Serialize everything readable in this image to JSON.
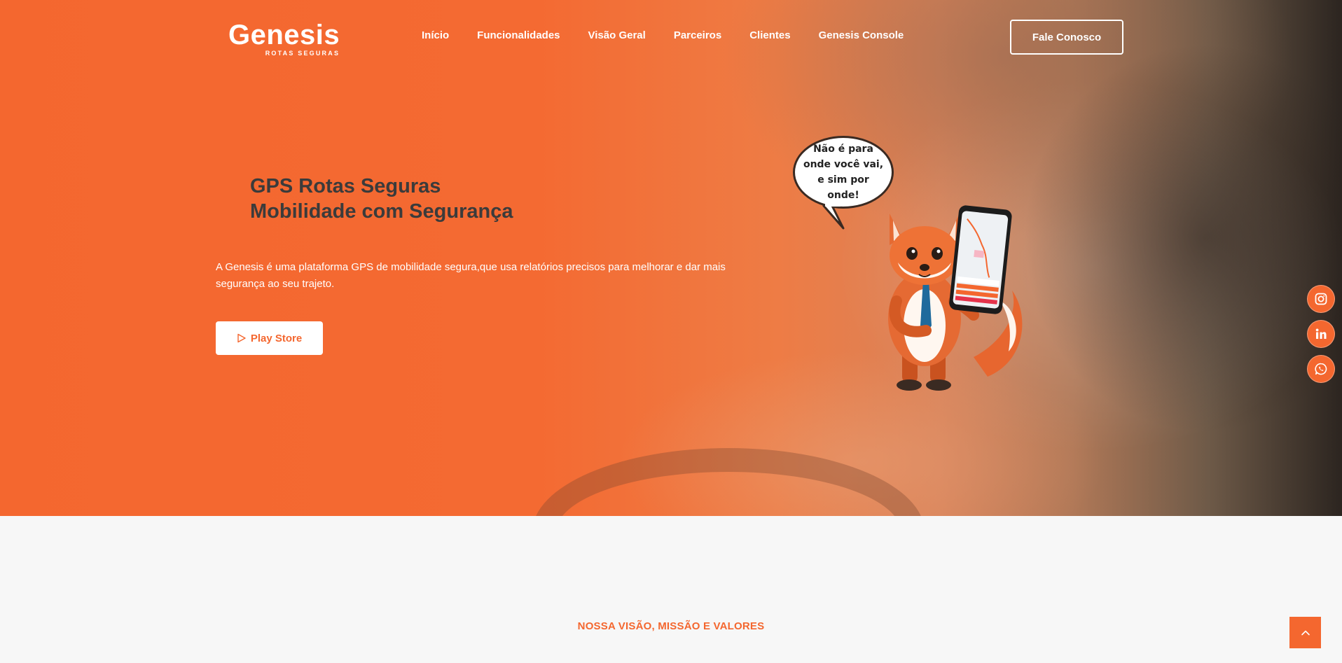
{
  "brand": {
    "name": "Genesis",
    "tagline": "ROTAS SEGURAS",
    "accent": "#f4672f"
  },
  "nav": {
    "items": [
      {
        "label": "Início"
      },
      {
        "label": "Funcionalidades"
      },
      {
        "label": "Visão Geral"
      },
      {
        "label": "Parceiros"
      },
      {
        "label": "Clientes"
      },
      {
        "label": "Genesis Console"
      }
    ],
    "cta_label": "Fale Conosco"
  },
  "hero": {
    "title_line1": "GPS Rotas Seguras",
    "title_line2": "Mobilidade com Segurança",
    "description": "A Genesis é uma plataforma GPS de mobilidade segura,que usa relatórios precisos para melhorar e dar mais segurança ao seu trajeto.",
    "play_store_label": "Play Store",
    "bubble_text": "Não é para onde você vai, e sim por onde!"
  },
  "social": [
    {
      "icon": "instagram-icon"
    },
    {
      "icon": "linkedin-icon"
    },
    {
      "icon": "whatsapp-icon"
    }
  ],
  "section": {
    "label": "NOSSA VISÃO, MISSÃO E VALORES"
  }
}
